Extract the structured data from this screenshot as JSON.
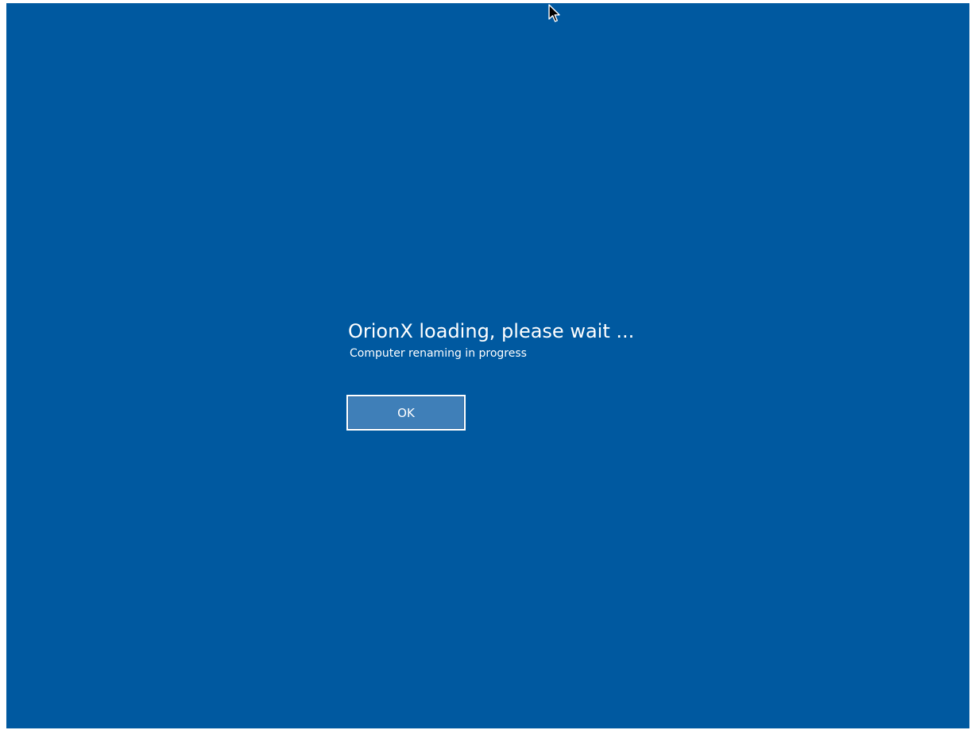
{
  "screen": {
    "background_color": "#0059a0",
    "text_color": "#ffffff"
  },
  "dialog": {
    "title": "OrionX loading, please wait ...",
    "subtitle": "Computer renaming in progress",
    "ok_label": "OK",
    "button_color": "#3f7fb8"
  },
  "cursor": {
    "icon": "mouse-pointer-icon"
  }
}
